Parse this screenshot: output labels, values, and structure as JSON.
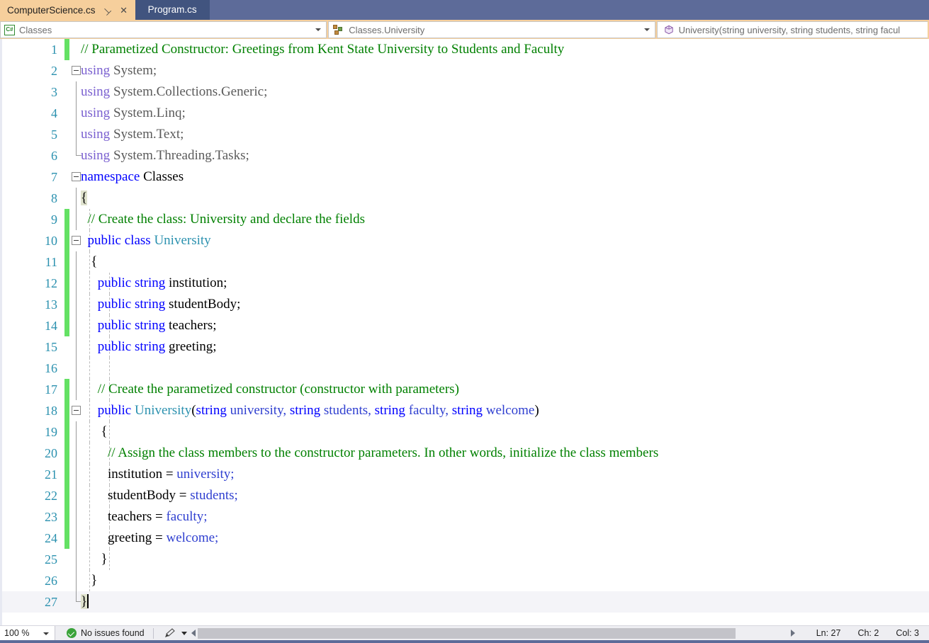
{
  "tabs": [
    {
      "label": "ComputerScience.cs",
      "active": true,
      "pin_icon": "pin-icon",
      "close_icon": "close-icon"
    },
    {
      "label": "Program.cs",
      "active": false
    }
  ],
  "navbar": {
    "project_dropdown": {
      "icon": "csharp-file-icon",
      "value": "Classes"
    },
    "type_dropdown": {
      "icon": "class-icon",
      "value": "Classes.University"
    },
    "member_dropdown": {
      "icon": "method-icon",
      "value": "University(string university, string students, string facul"
    }
  },
  "editor": {
    "lines": [
      {
        "n": "1",
        "changed": true,
        "indent": 0,
        "current": false
      },
      {
        "n": "2",
        "changed": false,
        "indent": 0,
        "current": false
      },
      {
        "n": "3",
        "changed": false,
        "indent": 0,
        "current": false
      },
      {
        "n": "4",
        "changed": false,
        "indent": 0,
        "current": false
      },
      {
        "n": "5",
        "changed": false,
        "indent": 0,
        "current": false
      },
      {
        "n": "6",
        "changed": false,
        "indent": 0,
        "current": false
      },
      {
        "n": "7",
        "changed": false,
        "indent": 0,
        "current": false
      },
      {
        "n": "8",
        "changed": false,
        "indent": 0,
        "current": false
      },
      {
        "n": "9",
        "changed": true,
        "indent": 0,
        "current": false
      },
      {
        "n": "10",
        "changed": true,
        "indent": 0,
        "current": false
      },
      {
        "n": "11",
        "changed": true,
        "indent": 0,
        "current": false
      },
      {
        "n": "12",
        "changed": true,
        "indent": 0,
        "current": false
      },
      {
        "n": "13",
        "changed": true,
        "indent": 0,
        "current": false
      },
      {
        "n": "14",
        "changed": true,
        "indent": 0,
        "current": false
      },
      {
        "n": "15",
        "changed": false,
        "indent": 0,
        "current": false
      },
      {
        "n": "16",
        "changed": false,
        "indent": 0,
        "current": false
      },
      {
        "n": "17",
        "changed": true,
        "indent": 0,
        "current": false
      },
      {
        "n": "18",
        "changed": true,
        "indent": 0,
        "current": false
      },
      {
        "n": "19",
        "changed": true,
        "indent": 0,
        "current": false
      },
      {
        "n": "20",
        "changed": true,
        "indent": 0,
        "current": false
      },
      {
        "n": "21",
        "changed": true,
        "indent": 0,
        "current": false
      },
      {
        "n": "22",
        "changed": true,
        "indent": 0,
        "current": false
      },
      {
        "n": "23",
        "changed": true,
        "indent": 0,
        "current": false
      },
      {
        "n": "24",
        "changed": true,
        "indent": 0,
        "current": false
      },
      {
        "n": "25",
        "changed": false,
        "indent": 0,
        "current": false
      },
      {
        "n": "26",
        "changed": false,
        "indent": 0,
        "current": false
      },
      {
        "n": "27",
        "changed": false,
        "indent": 0,
        "current": true
      }
    ],
    "code": {
      "l1_comment": "// Parametized Constructor: Greetings from Kent State University to Students and Faculty",
      "l2_kw": "using",
      "l2_ns": " System;",
      "l3_kw": "using",
      "l3_ns": " System.Collections.Generic;",
      "l4_kw": "using",
      "l4_ns": " System.Linq;",
      "l5_kw": "using",
      "l5_ns": " System.Text;",
      "l6_kw": "using",
      "l6_ns": " System.Threading.Tasks;",
      "l7_kw": "namespace",
      "l7_name": " Classes",
      "l8_brace": "{",
      "l9_comment": "// Create the class: University and declare the fields",
      "l10_kw": "public class",
      "l10_type": " University",
      "l11_brace": "{",
      "l12_kw": "public string",
      "l12_name": " institution;",
      "l13_kw": "public string",
      "l13_name": " studentBody;",
      "l14_kw": "public string",
      "l14_name": " teachers;",
      "l15_kw": "public string",
      "l15_name": " greeting;",
      "l17_comment": "// Create the parametized constructor (constructor with parameters)",
      "l18_kw": "public",
      "l18_type": " University",
      "l18_paren_open": "(",
      "l18_p1_kw": "string",
      "l18_p1_name": " university, ",
      "l18_p2_kw": "string",
      "l18_p2_name": " students, ",
      "l18_p3_kw": "string",
      "l18_p3_name": " faculty, ",
      "l18_p4_kw": "string",
      "l18_p4_name": " welcome",
      "l18_paren_close": ")",
      "l19_brace": "{",
      "l20_comment": "// Assign the class members to the constructor parameters. In other words, initialize the class members",
      "l21_lhs": "institution = ",
      "l21_rhs": "university;",
      "l22_lhs": "studentBody = ",
      "l22_rhs": "students;",
      "l23_lhs": "teachers = ",
      "l23_rhs": "faculty;",
      "l24_lhs": "greeting = ",
      "l24_rhs": "welcome;",
      "l25_brace": "}",
      "l26_brace": "}",
      "l27_brace": "}"
    }
  },
  "statusbar": {
    "zoom": "100 %",
    "issues_text": "No issues found",
    "issues_icon": "check-circle-icon",
    "brush_icon": "brush-icon",
    "line": "Ln: 27",
    "char": "Ch: 2",
    "col": "Col: 3"
  },
  "colors": {
    "tab_active_bg": "#f6cf9c",
    "tab_strip_bg": "#5d6b99",
    "comment": "#008000",
    "keyword": "#0000ff",
    "type": "#2b91af",
    "line_number": "#2b91af",
    "change_bar": "#64e164",
    "status_ok": "#3aa33a"
  }
}
